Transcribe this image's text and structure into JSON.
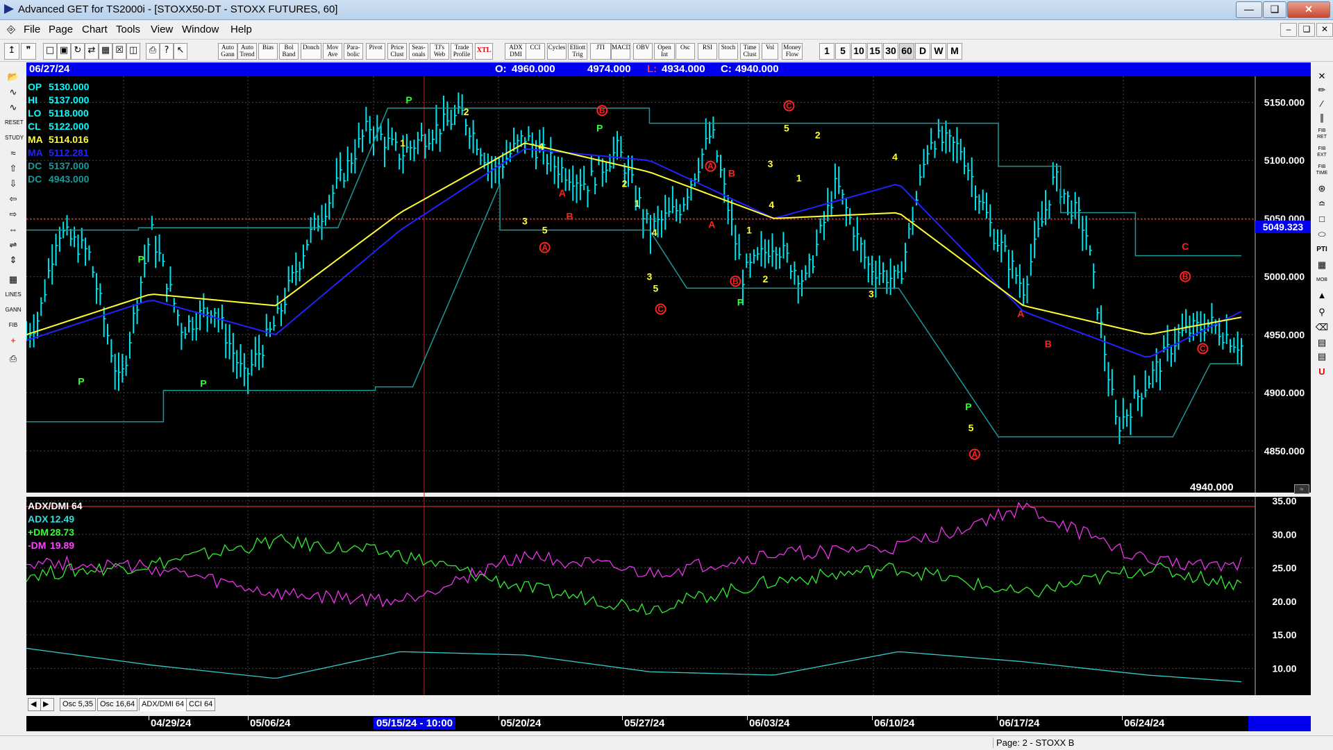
{
  "window": {
    "title": "Advanced GET for TS2000i - [STOXX50-DT - STOXX FUTURES, 60]"
  },
  "menu": {
    "items": [
      "File",
      "Page",
      "Chart",
      "Tools",
      "View",
      "Window",
      "Help"
    ]
  },
  "toolbar": {
    "study_buttons": [
      "Auto Gann",
      "Auto Trend",
      "Bias",
      "Bol Band",
      "Donch",
      "Mov Ave",
      "Para- bolic",
      "Pivot",
      "Price Clust",
      "Seas- onals",
      "TJ's Web",
      "Trade Profile",
      "XTL",
      "ADX DMI",
      "CCI",
      "Cycles",
      "Elliott Trig",
      "JTI",
      "MACD",
      "OBV",
      "Open Int",
      "Osc",
      "RSI",
      "Stoch",
      "Time Clust",
      "Vol",
      "Money Flow"
    ],
    "intervals": [
      "1",
      "5",
      "10",
      "15",
      "30",
      "60",
      "D",
      "W",
      "M"
    ],
    "active_interval": "60"
  },
  "header": {
    "date": "06/27/24",
    "open_label": "O:",
    "open": "4960.000",
    "high": "4974.000",
    "low_label": "L:",
    "low": "4934.000",
    "close_label": "C:",
    "close": "4940.000"
  },
  "legend_price": [
    {
      "label": "OP",
      "value": "5130.000",
      "color": "#00ffff"
    },
    {
      "label": "HI",
      "value": "5137.000",
      "color": "#00ffff"
    },
    {
      "label": "LO",
      "value": "5118.000",
      "color": "#00ffff"
    },
    {
      "label": "CL",
      "value": "5122.000",
      "color": "#00ffff"
    },
    {
      "label": "MA",
      "value": "5114.016",
      "color": "#ffff33"
    },
    {
      "label": "MA",
      "value": "5112.281",
      "color": "#2222ff"
    },
    {
      "label": "DC",
      "value": "5137.000",
      "color": "#1a9a9a"
    },
    {
      "label": "DC",
      "value": "4943.000",
      "color": "#1a9a9a"
    }
  ],
  "legend_osc": {
    "title": "ADX/DMI 64",
    "items": [
      {
        "label": "ADX",
        "value": "12.49",
        "color": "#33dddd"
      },
      {
        "label": "+DM",
        "value": "28.73",
        "color": "#33ff33"
      },
      {
        "label": "-DM",
        "value": "19.89",
        "color": "#ff44ff"
      }
    ]
  },
  "price_marker": "5049.323",
  "last_price": "4940.000",
  "tabs": [
    "Osc 5,35",
    "Osc 16,64",
    "ADX/DMI 64",
    "CCI 64"
  ],
  "active_tab": "ADX/DMI 64",
  "date_axis": {
    "labels": [
      "04/29/24",
      "05/06/24",
      "05/20/24",
      "05/27/24",
      "06/03/24",
      "06/10/24",
      "06/17/24",
      "06/24/24"
    ],
    "cursor_label": "05/15/24 - 10:00"
  },
  "status": "Page: 2 - STOXX B",
  "colors": {
    "price_bars": "#00e5ee",
    "ma_fast": "#ffff33",
    "ma_slow": "#2222ff",
    "donchian": "#1a9a9a",
    "adx": "#33cccc",
    "plus_dm": "#33ee33",
    "minus_dm": "#ee33ee",
    "wave_label": "#ffff33",
    "wave_circle": "#ff2222",
    "pivot": "#33ff33",
    "header_blue": "#0000ee"
  },
  "chart_data": [
    {
      "type": "candlestick",
      "title": "STOXX50-DT - STOXX FUTURES, 60",
      "y_ticks": [
        "5150.000",
        "5100.000",
        "5050.000",
        "5000.000",
        "4950.000",
        "4900.000",
        "4850.000"
      ],
      "ylim": [
        4820,
        5170
      ],
      "x_categories": [
        "04/29/24",
        "05/06/24",
        "05/20/24",
        "05/27/24",
        "06/03/24",
        "06/10/24",
        "06/17/24",
        "06/24/24"
      ],
      "series": [
        {
          "name": "Close",
          "x": [
            0,
            0.1,
            0.25,
            0.5,
            0.75,
            1,
            1.25,
            1.5,
            1.75,
            2,
            2.25,
            2.5,
            2.75,
            3,
            3.25,
            3.5,
            3.75,
            4,
            4.25,
            4.5,
            4.75,
            5,
            5.25,
            5.5,
            5.75,
            6,
            6.25,
            6.5,
            6.75,
            7,
            7.25,
            7.5,
            7.75,
            8,
            8.25,
            8.5,
            8.75,
            9,
            9.25,
            9.5,
            9.75
          ],
          "values": [
            4950,
            4965,
            5040,
            5020,
            4905,
            5040,
            4955,
            4975,
            4912,
            4960,
            5030,
            5080,
            5130,
            5105,
            5125,
            5140,
            5090,
            5120,
            5095,
            5080,
            5110,
            5040,
            5060,
            5125,
            5000,
            5030,
            4995,
            5080,
            5010,
            4995,
            5120,
            5110,
            5040,
            4990,
            5085,
            5040,
            4870,
            4910,
            4950,
            4960,
            4940
          ]
        },
        {
          "name": "MA fast",
          "x": [
            0,
            1,
            2,
            3,
            4,
            5,
            6,
            7,
            8,
            9,
            9.75
          ],
          "values": [
            4950,
            4985,
            4975,
            5055,
            5115,
            5090,
            5050,
            5055,
            4975,
            4950,
            4965
          ]
        },
        {
          "name": "MA slow",
          "x": [
            0,
            1,
            2,
            3,
            4,
            5,
            6,
            7,
            8,
            9,
            9.75
          ],
          "values": [
            4945,
            4980,
            4950,
            5040,
            5110,
            5100,
            5050,
            5080,
            4970,
            4930,
            4970
          ]
        }
      ],
      "wave_labels": [
        "P",
        "P",
        "P",
        "P",
        "1",
        "2",
        "3",
        "4",
        "5",
        "A",
        "B",
        "C",
        "2",
        "4",
        "5",
        "3",
        "1",
        "2",
        "P",
        "5",
        "A",
        "B",
        "C"
      ]
    },
    {
      "type": "line",
      "title": "ADX/DMI 64",
      "y_ticks": [
        "35.00",
        "30.00",
        "25.00",
        "20.00",
        "15.00",
        "10.00"
      ],
      "ylim": [
        6,
        35
      ],
      "series": [
        {
          "name": "ADX",
          "x": [
            0,
            1,
            2,
            3,
            4,
            5,
            6,
            7,
            8,
            9,
            9.75
          ],
          "values": [
            13,
            10.5,
            8.5,
            12.5,
            12,
            9.5,
            9,
            12.5,
            11,
            9,
            8
          ]
        },
        {
          "name": "+DM",
          "x": [
            0,
            1,
            2,
            3,
            4,
            5,
            6,
            7,
            8,
            9,
            9.75
          ],
          "values": [
            24,
            25.5,
            29,
            27,
            22,
            19,
            23,
            25,
            21,
            25,
            22.5
          ]
        },
        {
          "name": "-DM",
          "x": [
            0,
            1,
            2,
            3,
            4,
            5,
            6,
            7,
            8,
            9,
            9.75
          ],
          "values": [
            26,
            25,
            21,
            20,
            27,
            24,
            27,
            28,
            34,
            26,
            25.5
          ]
        }
      ]
    }
  ]
}
